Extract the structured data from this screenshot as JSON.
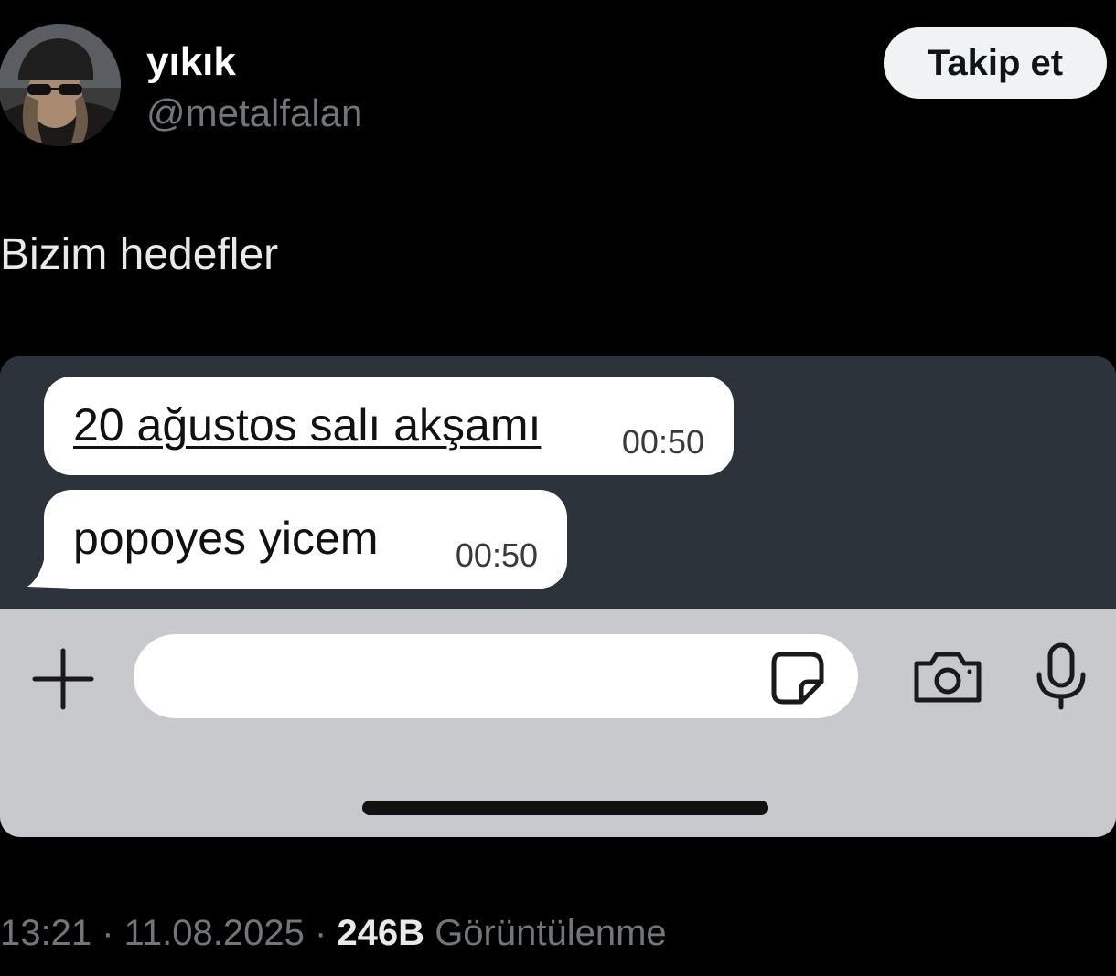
{
  "author": {
    "display_name": "yıkık",
    "handle": "@metalfalan",
    "avatar_icon": "profile-photo"
  },
  "follow_button": {
    "label": "Takip et"
  },
  "tweet": {
    "text": "Bizim hedefler"
  },
  "chat_screenshot": {
    "messages": [
      {
        "text": "20 ağustos salı akşamı",
        "time": "00:50"
      },
      {
        "text": "popoyes yicem",
        "time": "00:50"
      }
    ],
    "input": {
      "value": "",
      "placeholder": ""
    },
    "icons": {
      "add": "plus-icon",
      "sticker": "sticker-icon",
      "camera": "camera-icon",
      "mic": "microphone-icon"
    },
    "colors": {
      "chat_background": "#2d333a",
      "bubble": "#ffffff",
      "input_bar": "#c8c9cd"
    }
  },
  "meta": {
    "time": "13:21",
    "separator": " · ",
    "date": "11.08.2025",
    "views_count": "246B",
    "views_label": "Görüntülenme"
  },
  "colors": {
    "background": "#000000",
    "secondary_text": "#71767b",
    "follow_button_bg": "#eff3f4"
  }
}
